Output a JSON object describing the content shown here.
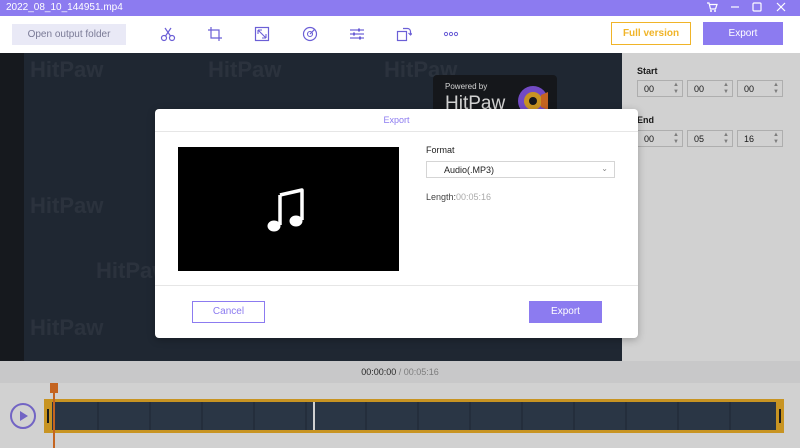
{
  "window": {
    "title": "2022_08_10_144951.mp4"
  },
  "toolbar": {
    "open_output_folder": "Open output folder",
    "tools": [
      "scissors-icon",
      "crop-icon",
      "resize-icon",
      "speed-icon",
      "adjust-icon",
      "rotate-icon",
      "more-icon"
    ],
    "full_version": "Full version",
    "export": "Export"
  },
  "preview": {
    "watermark": "HitPaw",
    "powered_by": "Powered by",
    "brand": "HitPaw"
  },
  "trim": {
    "start_label": "Start",
    "start": [
      "00",
      "00",
      "00"
    ],
    "end_label": "End",
    "end": [
      "00",
      "05",
      "16"
    ]
  },
  "timeline": {
    "current": "00:00:00",
    "separator": " / ",
    "total": "00:05:16"
  },
  "export_dialog": {
    "title": "Export",
    "format_label": "Format",
    "format_value": "Audio(.MP3)",
    "length_label": "Length:",
    "length_value": "00:05:16",
    "cancel": "Cancel",
    "export": "Export"
  },
  "colors": {
    "accent": "#8c7bf0",
    "gold": "#f0b428",
    "playhead": "#f07a28"
  }
}
